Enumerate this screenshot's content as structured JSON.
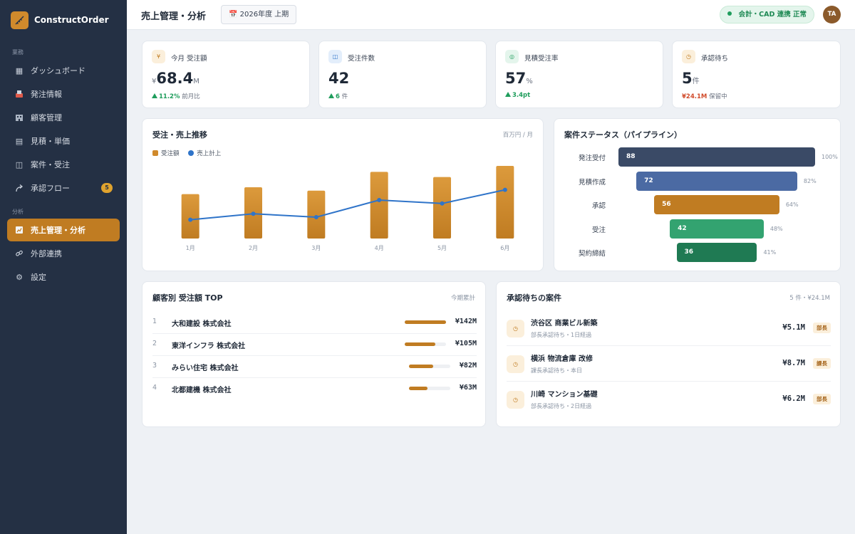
{
  "app": {
    "name": "ConstructOrder",
    "logo_icon": "ruler-icon",
    "accent": "#c07c22"
  },
  "sidebar": {
    "section_main": "業務",
    "section_analysis": "分析",
    "items": [
      {
        "label": "ダッシュボード",
        "icon": "grid-icon"
      },
      {
        "label": "発注情報",
        "icon": "inbox-icon"
      },
      {
        "label": "顧客管理",
        "icon": "building-icon"
      },
      {
        "label": "見積・単価",
        "icon": "list-icon"
      },
      {
        "label": "案件・受注",
        "icon": "folder-icon"
      },
      {
        "label": "承認フロー",
        "icon": "flow-icon",
        "badge": "5"
      },
      {
        "label": "売上管理・分析",
        "icon": "chart-icon",
        "active": true
      },
      {
        "label": "外部連携",
        "icon": "link-icon"
      },
      {
        "label": "設定",
        "icon": "gear-icon"
      }
    ]
  },
  "header": {
    "title": "売上管理・分析",
    "period": "2026年度 上期",
    "status": "会計・CAD 連携 正常",
    "avatar": "TA"
  },
  "kpis": [
    {
      "icon": "¥",
      "label": "今月 受注額",
      "prefix": "¥",
      "value": "68.4",
      "suffix": "M",
      "delta": "11.2%",
      "delta_note": "前月比"
    },
    {
      "icon": "◫",
      "label": "受注件数",
      "prefix": "",
      "value": "42",
      "suffix": "",
      "delta": "6",
      "delta_note": "件"
    },
    {
      "icon": "◎",
      "label": "見積受注率",
      "prefix": "",
      "value": "57",
      "suffix": "%",
      "delta": "3.4pt",
      "delta_note": ""
    },
    {
      "icon": "◷",
      "label": "承認待ち",
      "prefix": "",
      "value": "5",
      "suffix": "件",
      "delta": "¥24.1M",
      "delta_note": "保留中"
    }
  ],
  "trend": {
    "title": "受注・売上推移",
    "note": "百万円 / 月",
    "chart_data": {
      "type": "bar",
      "categories": [
        "1月",
        "2月",
        "3月",
        "4月",
        "5月",
        "6月"
      ],
      "series": [
        {
          "name": "受注額",
          "type": "bar",
          "color": "#d08a2c",
          "values": [
            52,
            60,
            56,
            78,
            72,
            85
          ]
        },
        {
          "name": "売上計上",
          "type": "line",
          "color": "#2f74c9",
          "values": [
            22,
            29,
            25,
            45,
            41,
            57
          ]
        }
      ],
      "ylim": [
        0,
        90
      ]
    }
  },
  "pipeline": {
    "title": "案件ステータス（パイプライン）",
    "stages": [
      {
        "label": "発注受付",
        "value": 88,
        "pct": "100%",
        "color": "#3a4a66"
      },
      {
        "label": "見積作成",
        "value": 72,
        "pct": "82%",
        "color": "#4b6aa3"
      },
      {
        "label": "承認",
        "value": 56,
        "pct": "64%",
        "color": "#c07c22"
      },
      {
        "label": "受注",
        "value": 42,
        "pct": "48%",
        "color": "#33a370"
      },
      {
        "label": "契約締結",
        "value": 36,
        "pct": "41%",
        "color": "#1f7a53"
      }
    ]
  },
  "customers": {
    "title": "顧客別 受注額 TOP",
    "note": "今期累計",
    "rows": [
      {
        "rank": "1",
        "name": "大和建設 株式会社",
        "amount": "¥142M",
        "share": 1.0
      },
      {
        "rank": "2",
        "name": "東洋インフラ 株式会社",
        "amount": "¥105M",
        "share": 0.74
      },
      {
        "rank": "3",
        "name": "みらい住宅 株式会社",
        "amount": "¥82M",
        "share": 0.58
      },
      {
        "rank": "4",
        "name": "北都建機 株式会社",
        "amount": "¥63M",
        "share": 0.44
      }
    ]
  },
  "approvals": {
    "title": "承認待ちの案件",
    "note": "5 件・¥24.1M",
    "rows": [
      {
        "title": "渋谷区 商業ビル新築",
        "sub": "部長承認待ち・1日経過",
        "amount": "¥5.1M",
        "badge": "部長"
      },
      {
        "title": "横浜 物流倉庫 改修",
        "sub": "課長承認待ち・本日",
        "amount": "¥8.7M",
        "badge": "課長"
      },
      {
        "title": "川崎 マンション基礎",
        "sub": "部長承認待ち・2日経過",
        "amount": "¥6.2M",
        "badge": "部長"
      }
    ]
  }
}
